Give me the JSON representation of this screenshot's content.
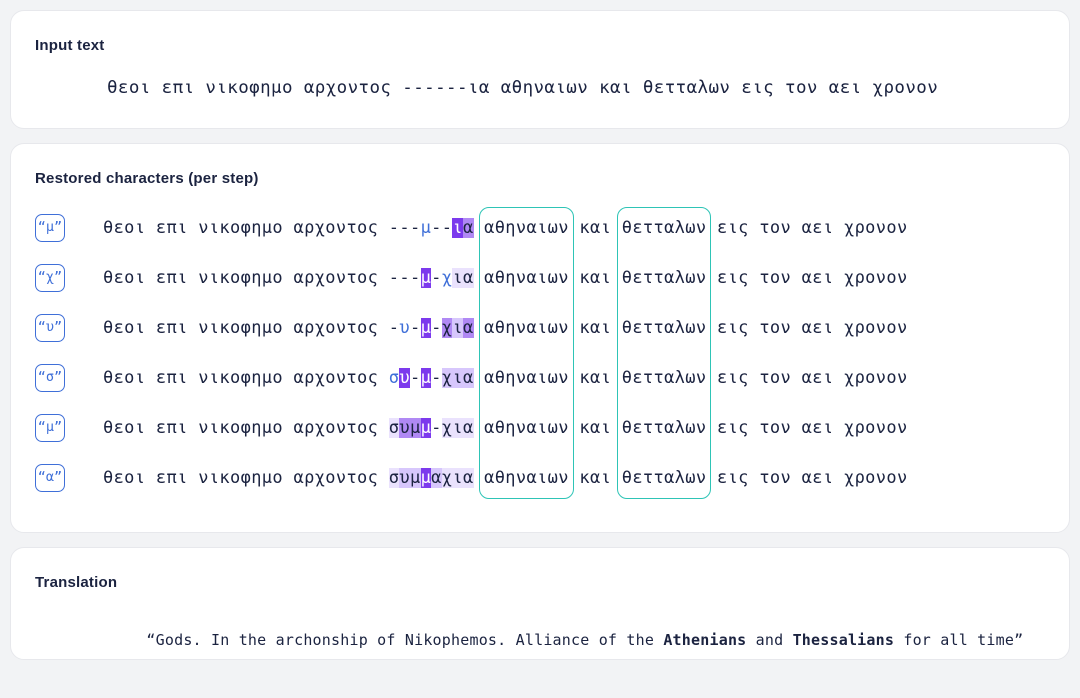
{
  "input_section": {
    "title": "Input text",
    "text": "θεοι επι νικοφημο αρχοντος ------ια αθηναιων και θετταλων εις τον αει χρονον"
  },
  "steps_section": {
    "title": "Restored characters (per step)",
    "rows": [
      {
        "badge": "“μ”",
        "badge_char": "μ",
        "prefix": "θεοι επι νικοφημο αρχοντος ",
        "gap": "---μ--ια",
        "suffix": " αθηναιων και θετταλων εις τον αει χρονον",
        "gap_cells": [
          {
            "ch": "-",
            "level": 0
          },
          {
            "ch": "-",
            "level": 0
          },
          {
            "ch": "-",
            "level": 0
          },
          {
            "ch": "μ",
            "level": 0,
            "predicted": true
          },
          {
            "ch": "-",
            "level": 0
          },
          {
            "ch": "-",
            "level": 0
          },
          {
            "ch": "ι",
            "level": 5
          },
          {
            "ch": "α",
            "level": 4
          }
        ]
      },
      {
        "badge": "“χ”",
        "badge_char": "χ",
        "prefix": "θεοι επι νικοφημο αρχοντος ",
        "gap": "---μ-χια",
        "suffix": " αθηναιων και θετταλων εις τον αει χρονον",
        "gap_cells": [
          {
            "ch": "-",
            "level": 0
          },
          {
            "ch": "-",
            "level": 0
          },
          {
            "ch": "-",
            "level": 0
          },
          {
            "ch": "μ",
            "level": 5
          },
          {
            "ch": "-",
            "level": 0
          },
          {
            "ch": "χ",
            "level": 0,
            "predicted": true
          },
          {
            "ch": "ι",
            "level": 2
          },
          {
            "ch": "α",
            "level": 2
          }
        ]
      },
      {
        "badge": "“υ”",
        "badge_char": "υ",
        "prefix": "θεοι επι νικοφημο αρχοντος ",
        "gap": "-υ-μ-χια",
        "suffix": " αθηναιων και θετταλων εις τον αει χρονον",
        "gap_cells": [
          {
            "ch": "-",
            "level": 0
          },
          {
            "ch": "υ",
            "level": 0,
            "predicted": true
          },
          {
            "ch": "-",
            "level": 0
          },
          {
            "ch": "μ",
            "level": 5
          },
          {
            "ch": "-",
            "level": 0
          },
          {
            "ch": "χ",
            "level": 4
          },
          {
            "ch": "ι",
            "level": 3
          },
          {
            "ch": "α",
            "level": 4
          }
        ]
      },
      {
        "badge": "“σ”",
        "badge_char": "σ",
        "prefix": "θεοι επι νικοφημο αρχοντος ",
        "gap": "συ-μ-χια",
        "suffix": " αθηναιων και θετταλων εις τον αει χρονον",
        "gap_cells": [
          {
            "ch": "σ",
            "level": 0,
            "predicted": true
          },
          {
            "ch": "υ",
            "level": 5
          },
          {
            "ch": "-",
            "level": 0
          },
          {
            "ch": "μ",
            "level": 5
          },
          {
            "ch": "-",
            "level": 0
          },
          {
            "ch": "χ",
            "level": 3
          },
          {
            "ch": "ι",
            "level": 3
          },
          {
            "ch": "α",
            "level": 3
          }
        ]
      },
      {
        "badge": "“μ”",
        "badge_char": "μ",
        "prefix": "θεοι επι νικοφημο αρχοντος ",
        "gap": "συμμ-χια",
        "suffix": " αθηναιων και θετταλων εις τον αει χρονον",
        "gap_cells": [
          {
            "ch": "σ",
            "level": 2
          },
          {
            "ch": "υ",
            "level": 4
          },
          {
            "ch": "μ",
            "level": 4
          },
          {
            "ch": "μ",
            "level": 5
          },
          {
            "ch": "-",
            "level": 0
          },
          {
            "ch": "χ",
            "level": 2
          },
          {
            "ch": "ι",
            "level": 2
          },
          {
            "ch": "α",
            "level": 2
          }
        ]
      },
      {
        "badge": "“α”",
        "badge_char": "α",
        "prefix": "θεοι επι νικοφημο αρχοντος ",
        "gap": "συμμαχια",
        "suffix": " αθηναιων και θετταλων εις τον αει χρονον",
        "gap_cells": [
          {
            "ch": "σ",
            "level": 2
          },
          {
            "ch": "υ",
            "level": 3
          },
          {
            "ch": "μ",
            "level": 3
          },
          {
            "ch": "μ",
            "level": 5
          },
          {
            "ch": "α",
            "level": 3
          },
          {
            "ch": "χ",
            "level": 2
          },
          {
            "ch": "ι",
            "level": 2
          },
          {
            "ch": "α",
            "level": 2
          }
        ]
      }
    ],
    "framed_words": [
      "αθηναιων",
      "θετταλων"
    ]
  },
  "translation_section": {
    "title": "Translation",
    "open_quote": "“Gods. In the archonship of Nikophemos. Alliance of the ",
    "bold_1": "Athenians",
    "middle": " and ",
    "bold_2": "Thessalians",
    "tail": " for all time”"
  },
  "colors": {
    "background": "#f2f3f5",
    "card": "#ffffff",
    "text": "#1b2340",
    "badge_border": "#3f6fd8",
    "frame_teal": "#2ec4b6",
    "highlight_purple": "#7c3aed"
  }
}
